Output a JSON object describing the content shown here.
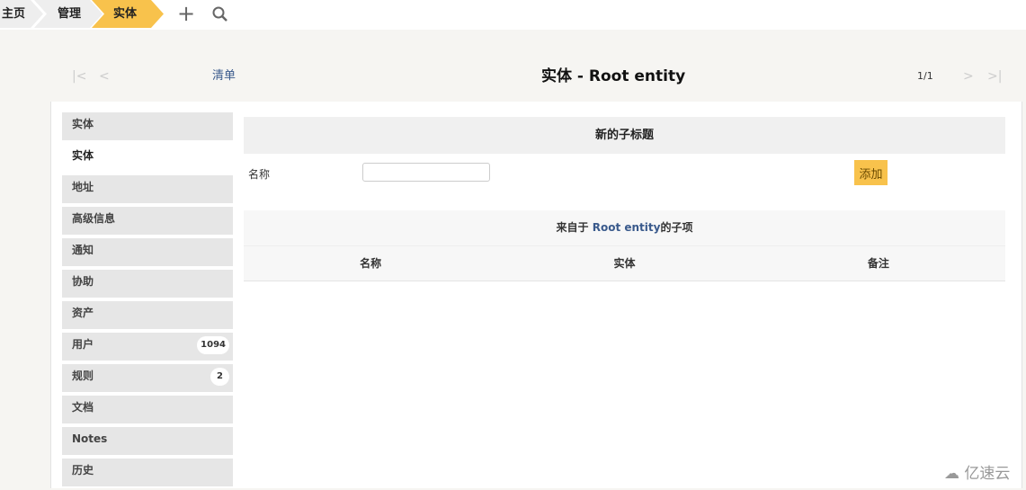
{
  "breadcrumb": [
    "主页",
    "管理",
    "实体"
  ],
  "toolbar": {
    "add_icon": "plus-icon",
    "search_icon": "search-icon"
  },
  "nav": {
    "list_label": "清单",
    "title": "实体 - Root entity",
    "pager": "1/1"
  },
  "sidebar": {
    "items": [
      {
        "label": "实体"
      },
      {
        "label": "实体"
      },
      {
        "label": "地址"
      },
      {
        "label": "高级信息"
      },
      {
        "label": "通知"
      },
      {
        "label": "协助"
      },
      {
        "label": "资产"
      },
      {
        "label": "用户",
        "badge": "1094"
      },
      {
        "label": "规则",
        "badge": "2"
      },
      {
        "label": "文档"
      },
      {
        "label": "Notes"
      },
      {
        "label": "历史"
      }
    ]
  },
  "form": {
    "header": "新的子标题",
    "name_label": "名称",
    "name_value": "",
    "add_button": "添加"
  },
  "children": {
    "title_prefix": "来自于 ",
    "title_link": "Root entity",
    "title_suffix": "的子项",
    "columns": [
      "名称",
      "实体",
      "备注"
    ]
  },
  "watermark": "亿速云",
  "colors": {
    "accent": "#f8c24c",
    "link": "#3a5a8c"
  }
}
